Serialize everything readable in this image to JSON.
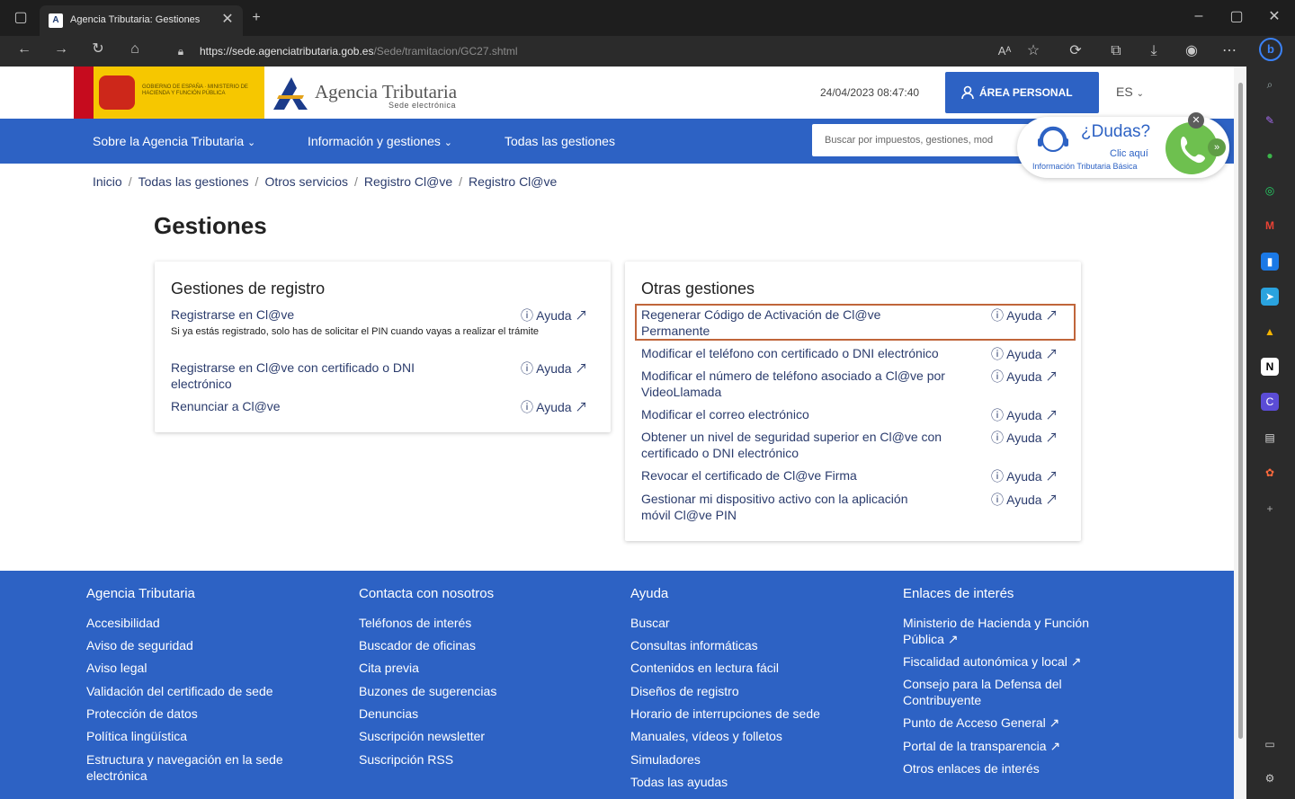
{
  "browser": {
    "tab_title": "Agencia Tributaria: Gestiones",
    "url_domain": "https://sede.agenciatributaria.gob.es",
    "url_path": "/Sede/tramitacion/GC27.shtml"
  },
  "header": {
    "gov_text": "GOBIERNO DE ESPAÑA",
    "ministry_text": "MINISTERIO DE HACIENDA Y FUNCIÓN PÚBLICA",
    "title": "Agencia Tributaria",
    "subtitle": "Sede electrónica",
    "datetime": "24/04/2023 08:47:40",
    "area_personal": "ÁREA PERSONAL",
    "lang": "ES"
  },
  "nav": {
    "items": [
      {
        "label": "Sobre la Agencia Tributaria"
      },
      {
        "label": "Información y gestiones"
      },
      {
        "label": "Todas las gestiones"
      }
    ],
    "search_placeholder": "Buscar por impuestos, gestiones, mod"
  },
  "dudas": {
    "title": "¿Dudas?",
    "clic": "Clic aquí",
    "info": "Información Tributaria Básica"
  },
  "breadcrumb": [
    "Inicio",
    "Todas las gestiones",
    "Otros servicios",
    "Registro Cl@ve",
    "Registro Cl@ve"
  ],
  "page_title": "Gestiones",
  "help_label": "Ayuda",
  "registro": {
    "title": "Gestiones de registro",
    "items": [
      {
        "label": "Registrarse en Cl@ve",
        "note": "Si ya estás registrado, solo has de solicitar el PIN cuando vayas a realizar el trámite"
      },
      {
        "label": "Registrarse en Cl@ve con certificado o DNI electrónico"
      },
      {
        "label": "Renunciar a Cl@ve"
      }
    ]
  },
  "otras": {
    "title": "Otras gestiones",
    "items": [
      {
        "label": "Regenerar Código de Activación de Cl@ve Permanente"
      },
      {
        "label": "Modificar el teléfono con certificado o DNI electrónico"
      },
      {
        "label": "Modificar el número de teléfono asociado a Cl@ve por VideoLlamada"
      },
      {
        "label": "Modificar el correo electrónico"
      },
      {
        "label": "Obtener un nivel de seguridad superior en Cl@ve con certificado o DNI electrónico"
      },
      {
        "label": "Revocar el certificado de Cl@ve Firma"
      },
      {
        "label": "Gestionar mi dispositivo activo con la aplicación móvil Cl@ve PIN"
      }
    ]
  },
  "footer": {
    "columns": [
      {
        "title": "Agencia Tributaria",
        "links": [
          "Accesibilidad",
          "Aviso de seguridad",
          "Aviso legal",
          "Validación del certificado de sede",
          "Protección de datos",
          "Política lingüística",
          "Estructura y navegación en la sede electrónica"
        ]
      },
      {
        "title": "Contacta con nosotros",
        "links": [
          "Teléfonos de interés",
          "Buscador de oficinas",
          "Cita previa",
          "Buzones de sugerencias",
          "Denuncias",
          "Suscripción newsletter",
          "Suscripción RSS"
        ]
      },
      {
        "title": "Ayuda",
        "links": [
          "Buscar",
          "Consultas informáticas",
          "Contenidos en lectura fácil",
          "Diseños de registro",
          "Horario de interrupciones de sede",
          "Manuales, vídeos y folletos",
          "Simuladores",
          "Todas las ayudas"
        ]
      },
      {
        "title": "Enlaces de interés",
        "links": [
          "Ministerio de Hacienda y Función Pública",
          "Fiscalidad autonómica y local",
          "Consejo para la Defensa del Contribuyente",
          "Punto de Acceso General",
          "Portal de la transparencia",
          "Otros enlaces de interés"
        ]
      }
    ]
  }
}
